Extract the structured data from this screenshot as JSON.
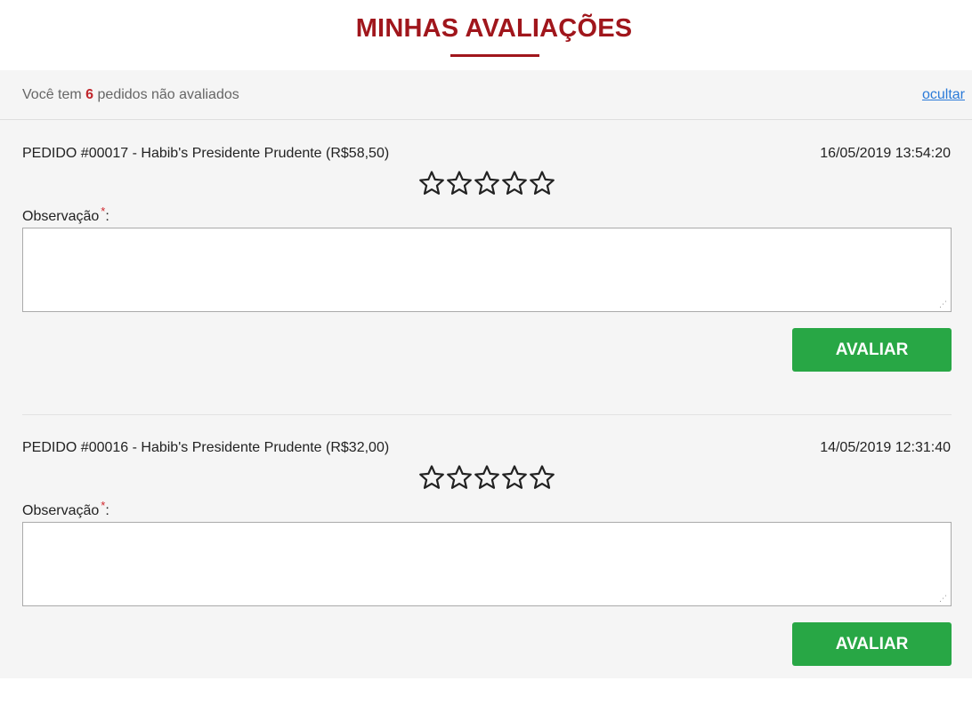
{
  "page": {
    "title": "MINHAS AVALIAÇÕES",
    "accent_color": "#a0161c"
  },
  "summary": {
    "prefix": "Você tem",
    "count": "6",
    "suffix": "pedidos não avaliados",
    "hide_label": "ocultar"
  },
  "orders": [
    {
      "title": "PEDIDO #00017 - Habib's Presidente Prudente (R$58,50)",
      "date": "16/05/2019 13:54:20",
      "rating": 0,
      "max_rating": 5,
      "obs_label": "Observação",
      "required_mark": "*",
      "obs_suffix": ":",
      "obs_value": "",
      "button_label": "AVALIAR"
    },
    {
      "title": "PEDIDO #00016 - Habib's Presidente Prudente (R$32,00)",
      "date": "14/05/2019 12:31:40",
      "rating": 0,
      "max_rating": 5,
      "obs_label": "Observação",
      "required_mark": "*",
      "obs_suffix": ":",
      "obs_value": "",
      "button_label": "AVALIAR"
    }
  ],
  "colors": {
    "button": "#28a745",
    "link": "#2a7ad8",
    "panel_bg": "#f5f5f5"
  },
  "icons": {
    "star": "star-outline-icon",
    "resize": "resize-grip-icon"
  }
}
